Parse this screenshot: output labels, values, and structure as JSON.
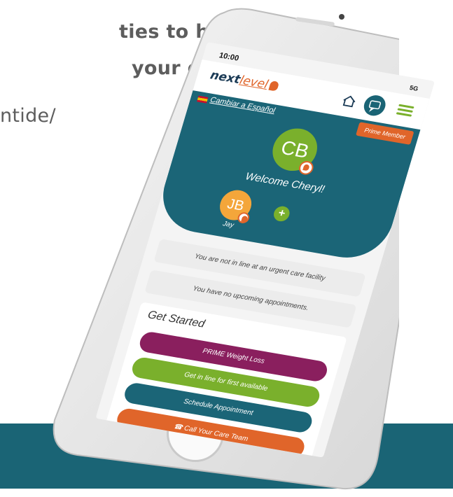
{
  "background_text": {
    "line1": "ties to have",
    "line2": "your door.",
    "line3": "ntide/"
  },
  "colors": {
    "teal": "#1b6577",
    "green": "#7ab02c",
    "orange": "#e0652a",
    "plum": "#8a1f5e",
    "band": "#1a6475"
  },
  "status_bar": {
    "time": "10:00",
    "signal": "5G"
  },
  "app": {
    "logo_main": "next",
    "logo_level": "level",
    "home_icon": "home-icon",
    "chat_icon": "chat-icon",
    "menu_icon": "hamburger-menu-icon"
  },
  "hero": {
    "language_link": "Cambiar a Español",
    "prime_badge": "Prime Member",
    "user_initials": "CB",
    "welcome": "Welcome Cheryl!",
    "dependent_initials": "JB",
    "dependent_name": "Jay",
    "add_label": "+"
  },
  "messages": {
    "line_status": "You are not in line at an urgent care facility",
    "appointments": "You have no upcoming appointments."
  },
  "get_started": {
    "title": "Get Started",
    "buttons": [
      {
        "label": "PRIME Weight Loss",
        "color": "#8a1f5e"
      },
      {
        "label": "Get in line for first available",
        "color": "#7ab02c"
      },
      {
        "label": "Schedule Appointment",
        "color": "#1b6577"
      },
      {
        "label": "Call Your Care Team",
        "color": "#e0652a"
      }
    ]
  }
}
